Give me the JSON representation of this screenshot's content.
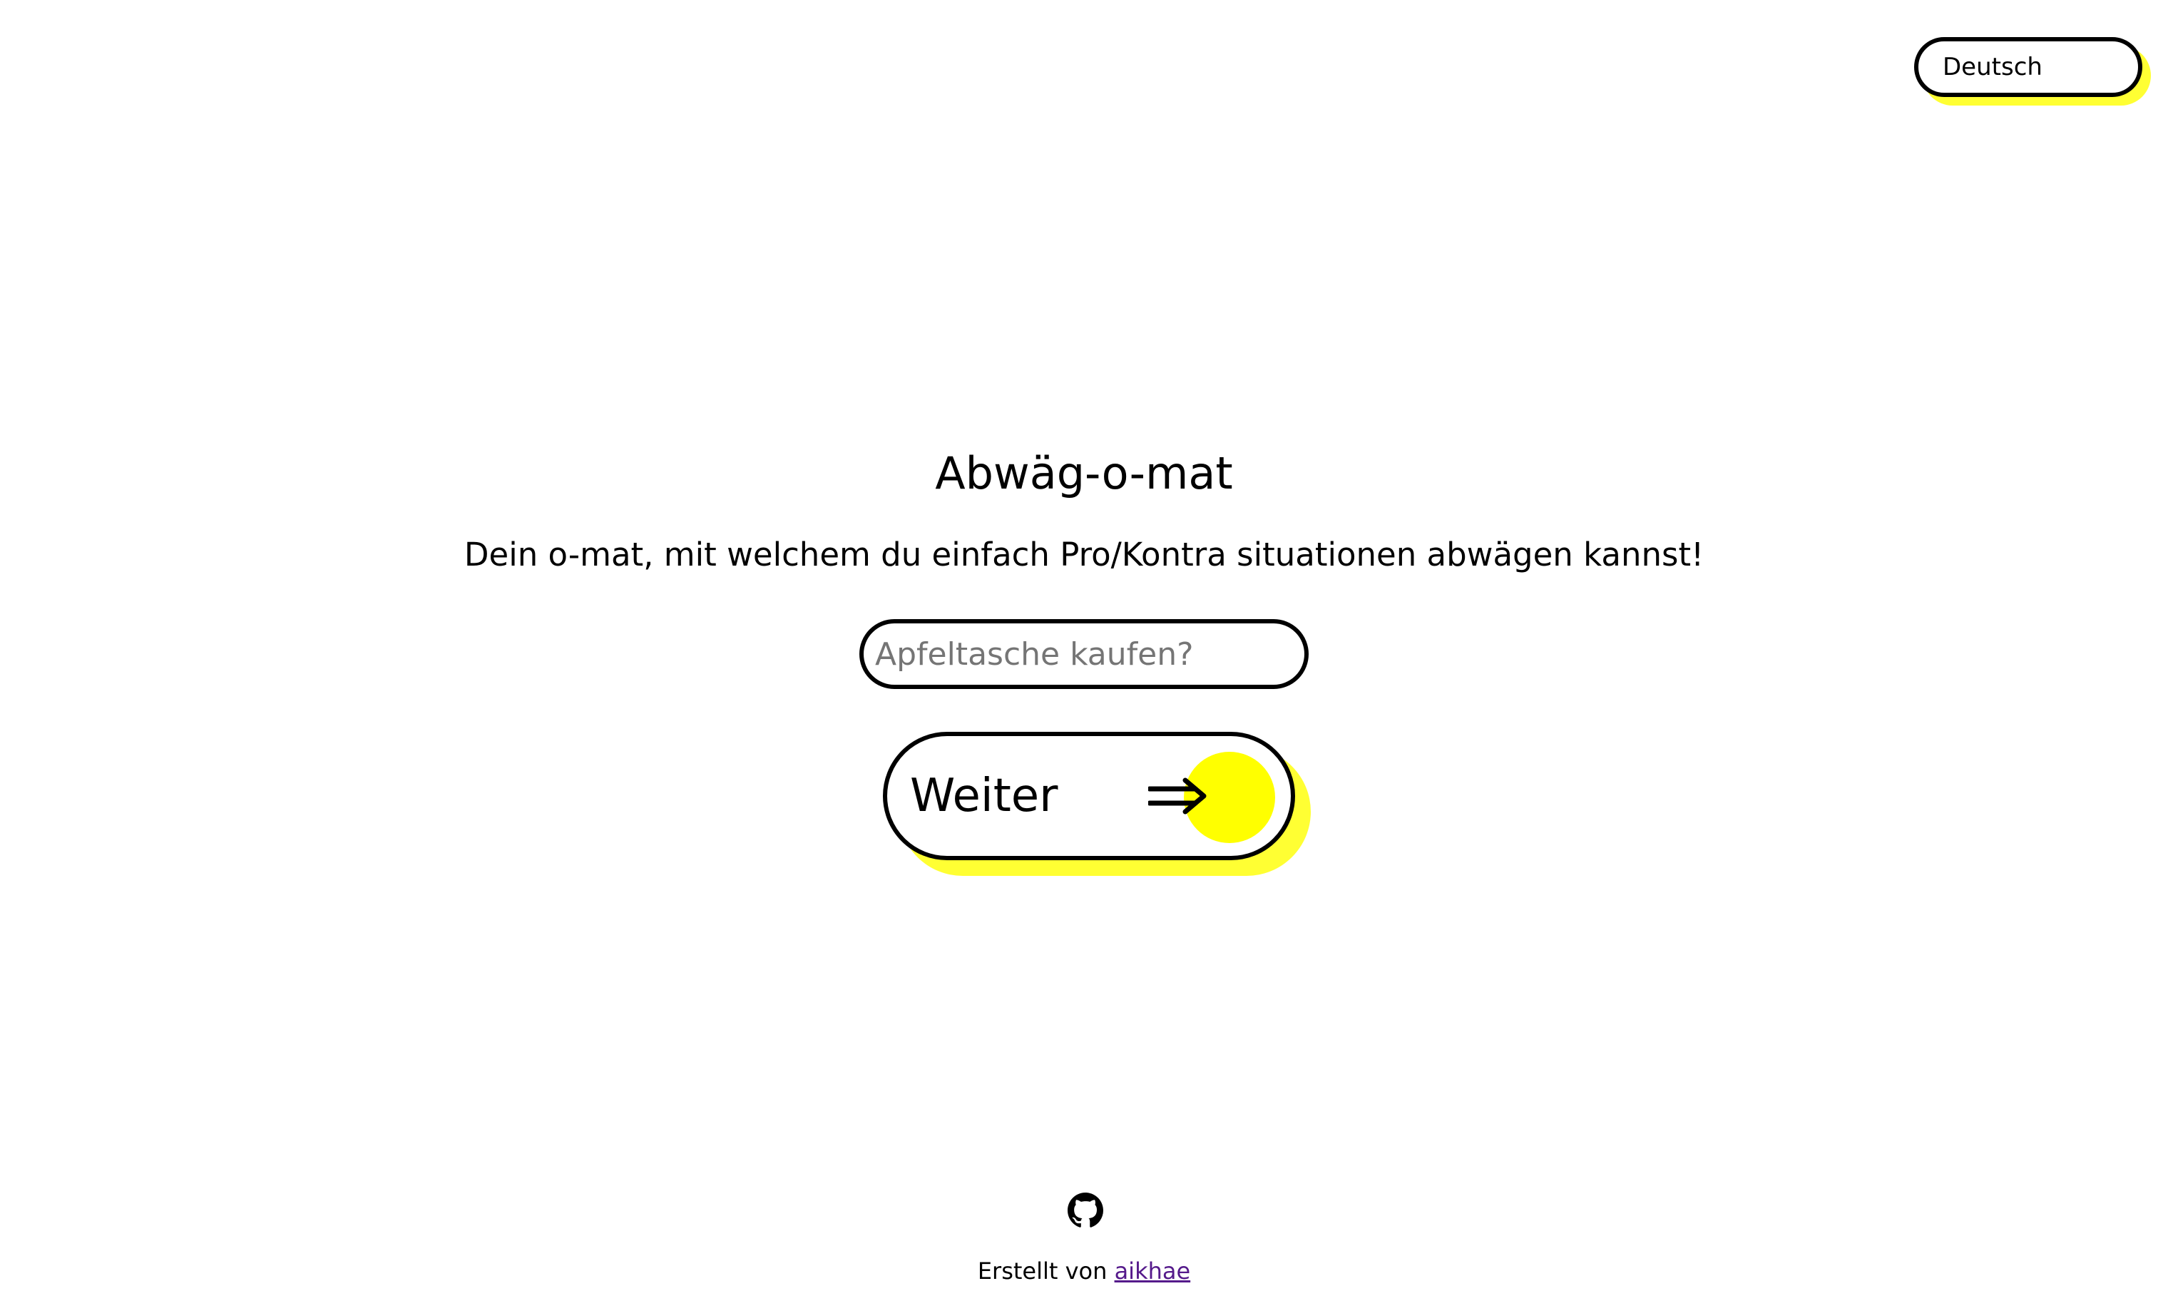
{
  "language_selector": {
    "selected": "Deutsch"
  },
  "header": {
    "title": "Abwäg-o-mat",
    "subtitle": "Dein o-mat, mit welchem du einfach Pro/Kontra situationen abwägen kannst!"
  },
  "question": {
    "placeholder": "Apfeltasche kaufen?",
    "value": ""
  },
  "next_button": {
    "label": "Weiter",
    "icon": "double-arrow-right-icon"
  },
  "footer": {
    "icon": "github-icon",
    "created_by": "Erstellt von",
    "author": "aikhae"
  },
  "colors": {
    "accent": "#ffff00",
    "shadow": "#ffff33",
    "border": "#000000",
    "link": "#551a8b"
  }
}
